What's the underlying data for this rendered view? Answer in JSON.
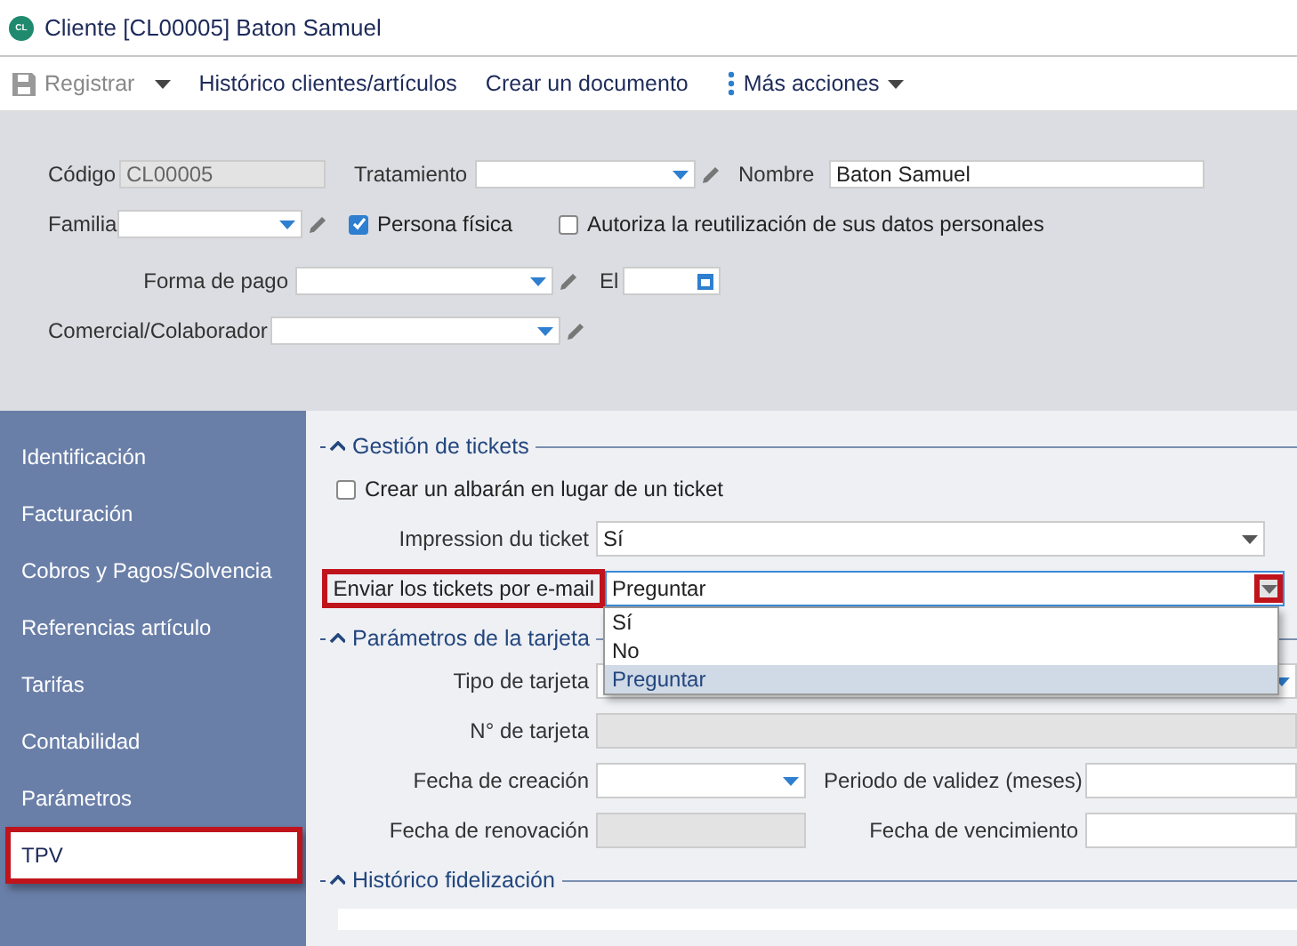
{
  "window": {
    "logo": "CL",
    "title": "Cliente [CL00005] Baton Samuel"
  },
  "toolbar": [
    {
      "kind": "save",
      "label": "Registrar",
      "disabled": true
    },
    {
      "kind": "link",
      "label": "Histórico clientes/artículos",
      "disabled": false
    },
    {
      "kind": "link",
      "label": "Crear un documento",
      "disabled": false
    },
    {
      "kind": "more",
      "label": "Más acciones",
      "disabled": false
    }
  ],
  "header": {
    "rows": [
      [
        {
          "kind": "text",
          "label": "Código",
          "value": "CL00005",
          "disabled": true
        },
        {
          "kind": "select",
          "label": "Tratamiento"
        },
        {
          "kind": "text",
          "label": "Nombre",
          "value": "Baton Samuel",
          "disabled": false
        }
      ],
      [
        {
          "kind": "select",
          "label": "Familia"
        },
        {
          "kind": "checkbox",
          "label": "Persona física",
          "checked": true
        },
        {
          "kind": "checkbox",
          "label": "Autoriza la reutilización de sus datos personales",
          "checked": false
        }
      ],
      [
        {
          "kind": "select",
          "label": "Forma de pago"
        },
        {
          "kind": "date",
          "label": "El"
        }
      ],
      [
        {
          "kind": "select",
          "label": "Comercial/Colaborador"
        }
      ]
    ]
  },
  "sidebar": {
    "items": [
      {
        "label": "Identificación",
        "selected": false
      },
      {
        "label": "Facturación",
        "selected": false
      },
      {
        "label": "Cobros y Pagos/Solvencia",
        "selected": false
      },
      {
        "label": "Referencias artículo",
        "selected": false
      },
      {
        "label": "Tarifas",
        "selected": false
      },
      {
        "label": "Contabilidad",
        "selected": false
      },
      {
        "label": "Parámetros",
        "selected": false
      },
      {
        "label": "TPV",
        "selected": true
      }
    ]
  },
  "sections": [
    {
      "title": "Gestión de tickets",
      "rows": [
        [
          {
            "kind": "checkbox",
            "label": "Crear un albarán en lugar de un ticket",
            "checked": false
          }
        ],
        [
          {
            "kind": "combo",
            "label": "Impression du ticket",
            "value": "Sí"
          }
        ],
        [
          {
            "kind": "combo",
            "label": "Enviar los tickets por e-mail",
            "value": "Preguntar",
            "open": true,
            "options": [
              {
                "label": "Sí",
                "selected": false
              },
              {
                "label": "No",
                "selected": false
              },
              {
                "label": "Preguntar",
                "selected": true
              }
            ]
          }
        ]
      ]
    },
    {
      "title": "Parámetros de la tarjeta",
      "rows": [
        [
          {
            "kind": "combo",
            "label": "Tipo de tarjeta"
          }
        ],
        [
          {
            "kind": "text",
            "label": "N° de tarjeta",
            "disabled": true
          }
        ],
        [
          {
            "kind": "date",
            "label": "Fecha de creación"
          },
          {
            "kind": "text",
            "label": "Periodo de validez (meses)",
            "disabled": false
          }
        ],
        [
          {
            "kind": "text",
            "label": "Fecha de renovación",
            "disabled": true
          },
          {
            "kind": "text",
            "label": "Fecha de vencimiento",
            "disabled": false
          }
        ]
      ]
    },
    {
      "title": "Histórico fidelización"
    }
  ]
}
